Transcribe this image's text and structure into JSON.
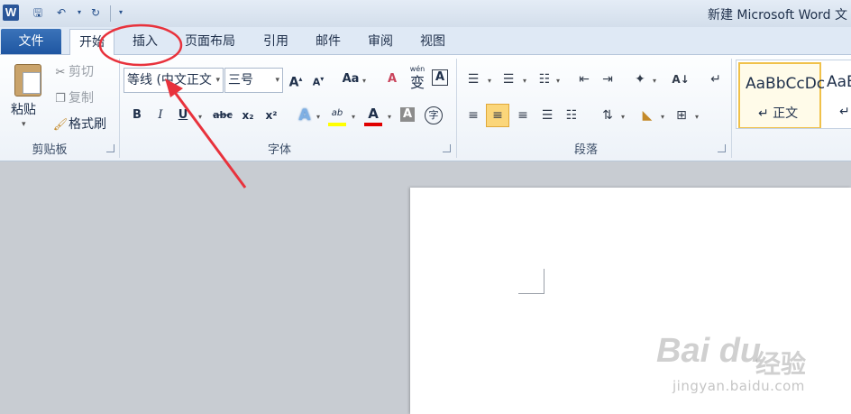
{
  "window": {
    "app_icon": "W",
    "title": "新建 Microsoft Word 文"
  },
  "quick_access": [
    "save-icon",
    "undo-icon",
    "dropdown-icon",
    "redo-icon",
    "customize-icon"
  ],
  "tabs": {
    "file": "文件",
    "items": [
      "开始",
      "插入",
      "页面布局",
      "引用",
      "邮件",
      "审阅",
      "视图"
    ],
    "active": "开始"
  },
  "clipboard": {
    "paste": "粘贴",
    "cut": "剪切",
    "copy": "复制",
    "format_painter": "格式刷",
    "label": "剪贴板"
  },
  "font": {
    "font_name": "等线 (中文正文",
    "font_size": "三号",
    "grow": "A",
    "shrink": "A",
    "change_case": "Aa",
    "clear_format": "A",
    "phonetic": "wén",
    "phonetic_char": "变",
    "border_char": "A",
    "bold": "B",
    "italic": "I",
    "underline": "U",
    "strikethrough": "abc",
    "subscript": "x₂",
    "superscript": "x²",
    "text_effect": "A",
    "highlight": "ab",
    "font_color": "A",
    "char_shading": "A",
    "enclose": "字",
    "label": "字体",
    "highlight_color": "#ffff00",
    "font_color_value": "#e00000"
  },
  "paragraph": {
    "label": "段落"
  },
  "styles": {
    "items": [
      {
        "sample": "AaBbCcDc",
        "name": "↵ 正文"
      },
      {
        "sample": "AaBl",
        "name": "↵ 无"
      }
    ]
  },
  "watermark": {
    "brand": "Bai  du",
    "cn": "经验",
    "url": "jingyan.baidu.com"
  },
  "annotation_color": "#e8323c"
}
